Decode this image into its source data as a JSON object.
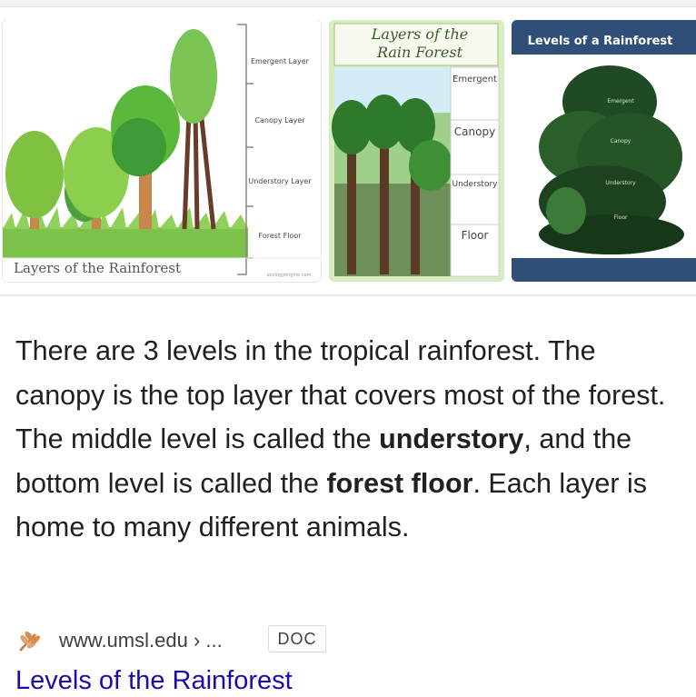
{
  "images": [
    {
      "caption": "Layers of the Rainforest",
      "layers": [
        "Emergent Layer",
        "Canopy Layer",
        "Understory Layer",
        "Forest Floor"
      ],
      "credit": "ecologyengine.com"
    },
    {
      "title_line1": "Layers of the",
      "title_line2": "Rain Forest",
      "layers": [
        "Emergent",
        "Canopy",
        "Understory",
        "Floor"
      ]
    },
    {
      "title": "Levels of a Rainforest",
      "layers": [
        "Emergent",
        "Canopy",
        "Understory",
        "Floor"
      ]
    }
  ],
  "snippet": {
    "part1": "There are 3 levels in the tropical rainforest. The canopy is the top layer that covers most of the forest. The middle level is called the ",
    "bold1": "understory",
    "part2": ", and the bottom level is called the ",
    "bold2": "forest floor",
    "part3": ". Each layer is home to many different animals."
  },
  "source": {
    "url": "www.umsl.edu › ...",
    "badge": "DOC",
    "title": "Levels of the Rainforest",
    "favicon": "wheat-logo-icon"
  },
  "colors": {
    "link": "#1a0dab",
    "text": "#202124",
    "thumb3_bg": "#2f4e78"
  }
}
